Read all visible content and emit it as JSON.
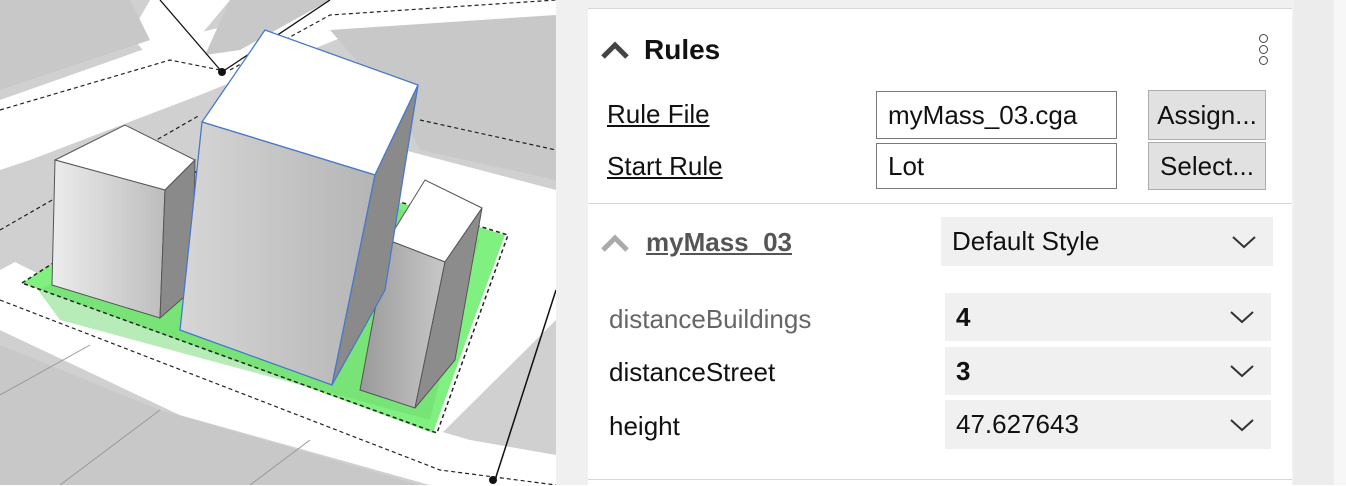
{
  "rules_section": {
    "title": "Rules",
    "rule_file_label": "Rule File",
    "rule_file_value": "myMass_03.cga",
    "assign_button": "Assign...",
    "start_rule_label": "Start Rule",
    "start_rule_value": "Lot",
    "select_button": "Select..."
  },
  "mass_section": {
    "title": "myMass_03",
    "style_value": "Default Style",
    "attributes": [
      {
        "name": "distanceBuildings",
        "value": "4"
      },
      {
        "name": "distanceStreet",
        "value": "3"
      },
      {
        "name": "height",
        "value": "47.627643"
      }
    ]
  },
  "colors": {
    "lot_green": "#80f080",
    "building_top": "#ffffff",
    "building_side": "#a8a8a8",
    "selection_outline": "#4a78c8"
  }
}
